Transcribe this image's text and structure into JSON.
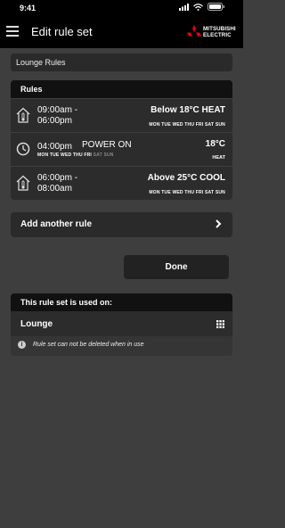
{
  "status": {
    "time": "9:41"
  },
  "header": {
    "title": "Edit rule set",
    "brand_line1": "MITSUBISHI",
    "brand_line2": "ELECTRIC"
  },
  "rule_set_name": "Lounge Rules",
  "rules": {
    "heading": "Rules",
    "items": [
      {
        "icon": "house-thermometer-icon",
        "start": "09:00am -",
        "end": "06:00pm",
        "mode": "Below 18°C HEAT",
        "days_on": "MON TUE WED THU FRI SAT SUN",
        "days_off": ""
      },
      {
        "icon": "clock-icon",
        "start": "04:00pm",
        "action": "POWER ON",
        "temp": "18°C",
        "mode2": "HEAT",
        "days_on": "MON TUE WED THU FRI",
        "days_off": "SAT SUN"
      },
      {
        "icon": "house-thermometer-icon",
        "start": "06:00pm -",
        "end": "08:00am",
        "mode": "Above 25°C COOL",
        "days_on": "MON TUE WED THU FRI SAT SUN",
        "days_off": ""
      }
    ]
  },
  "add_rule": {
    "label": "Add another rule"
  },
  "done": {
    "label": "Done"
  },
  "used_on": {
    "heading": "This rule set is used on:",
    "location": "Lounge",
    "note": "Rule set can not be deleted when in use"
  },
  "colors": {
    "background": "#3e3e3e",
    "card": "#2c2c2c",
    "header": "#111111"
  }
}
